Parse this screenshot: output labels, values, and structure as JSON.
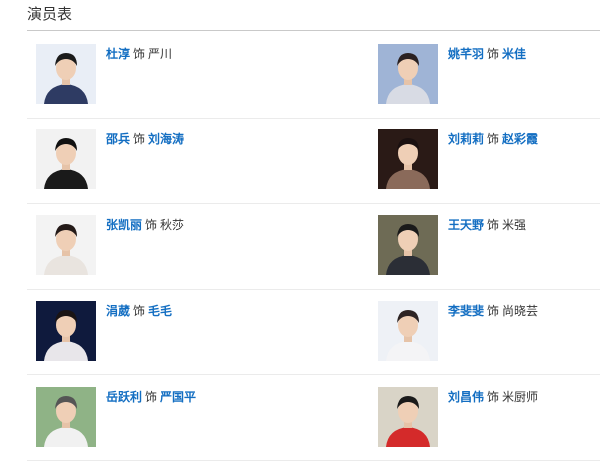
{
  "section": {
    "title": "演员表"
  },
  "as_label": "饰",
  "cast": [
    {
      "actor": "杜淳",
      "role": "严川",
      "role_is_link": false,
      "photo_bg": "#e9eef6",
      "photo_fg": "#2e3b63",
      "photo_hair": "#1b1b1b",
      "photo_name": "actor-portrait-dress-suit"
    },
    {
      "actor": "姚芊羽",
      "role": "米佳",
      "role_is_link": true,
      "photo_bg": "#9fb4d6",
      "photo_fg": "#d8dbe4",
      "photo_hair": "#2a2122",
      "photo_name": "actor-portrait-updo"
    },
    {
      "actor": "邵兵",
      "role": "刘海涛",
      "role_is_link": true,
      "photo_bg": "#f2f2f2",
      "photo_fg": "#1a1a1a",
      "photo_hair": "#111111",
      "photo_name": "actor-portrait-black-suit"
    },
    {
      "actor": "刘莉莉",
      "role": "赵彩霞",
      "role_is_link": true,
      "photo_bg": "#2a1a16",
      "photo_fg": "#8a6a5a",
      "photo_hair": "#1a1010",
      "photo_name": "actor-portrait-dark-background"
    },
    {
      "actor": "张凯丽",
      "role": "秋莎",
      "role_is_link": false,
      "photo_bg": "#f3f3f3",
      "photo_fg": "#e9e4df",
      "photo_hair": "#241a18",
      "photo_name": "actor-portrait-white-top"
    },
    {
      "actor": "王天野",
      "role": "米强",
      "role_is_link": false,
      "photo_bg": "#6e6b55",
      "photo_fg": "#2b2e36",
      "photo_hair": "#1a1a1a",
      "photo_name": "actor-portrait-gray-suit"
    },
    {
      "actor": "涓葳",
      "role": "毛毛",
      "role_is_link": true,
      "photo_bg": "#0f1a3d",
      "photo_fg": "#e8e6ea",
      "photo_hair": "#1a1414",
      "photo_name": "actor-portrait-white-dress"
    },
    {
      "actor": "李斐斐",
      "role": "尚晓芸",
      "role_is_link": false,
      "photo_bg": "#eef1f6",
      "photo_fg": "#f4f4f6",
      "photo_hair": "#2d2424",
      "photo_name": "actor-portrait-long-hair"
    },
    {
      "actor": "岳跃利",
      "role": "严国平",
      "role_is_link": true,
      "photo_bg": "#8fb386",
      "photo_fg": "#f1f1f1",
      "photo_hair": "#555555",
      "photo_name": "actor-portrait-white-shirt"
    },
    {
      "actor": "刘昌伟",
      "role": "米厨师",
      "role_is_link": false,
      "photo_bg": "#d9d4c7",
      "photo_fg": "#d42a2a",
      "photo_hair": "#1a1a1a",
      "photo_name": "actor-portrait-red-shirt"
    }
  ]
}
